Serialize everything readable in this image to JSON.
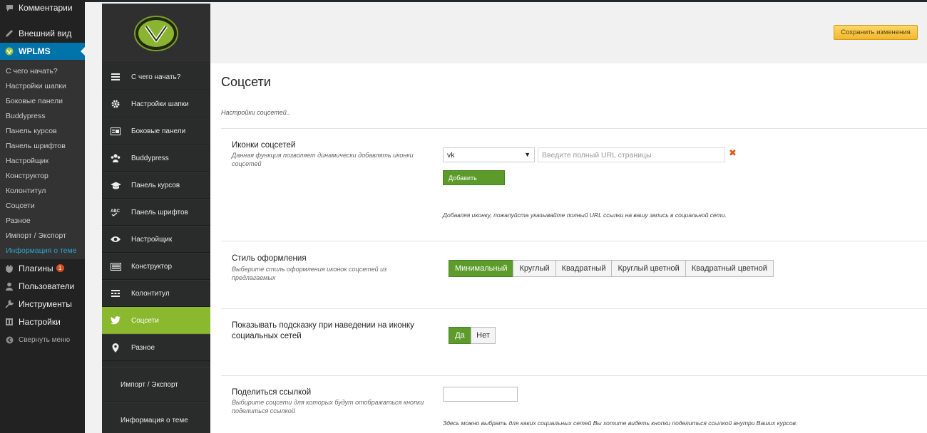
{
  "wp_menu": {
    "top_items": [
      {
        "label": "Комментарии",
        "icon": "comment-icon"
      },
      {
        "label": "Внешний вид",
        "icon": "paintbrush-icon"
      },
      {
        "label": "WPLMS",
        "icon": "wplms-logo-icon"
      }
    ],
    "sub_items": [
      "С чего начать?",
      "Настройки шапки",
      "Боковые панели",
      "Buddypress",
      "Панель курсов",
      "Панель шрифтов",
      "Настройщик",
      "Конструктор",
      "Колонтитул",
      "Соцсети",
      "Разное",
      "Импорт / Экспорт",
      "Информация о теме"
    ],
    "bottom_items": [
      {
        "label": "Плагины",
        "icon": "plugin-icon",
        "badge": "1"
      },
      {
        "label": "Пользователи",
        "icon": "user-icon"
      },
      {
        "label": "Инструменты",
        "icon": "wrench-icon"
      },
      {
        "label": "Настройки",
        "icon": "settings-icon"
      },
      {
        "label": "Свернуть меню",
        "icon": "collapse-icon"
      }
    ]
  },
  "options_sidebar": {
    "items": [
      {
        "label": "С чего начать?",
        "icon": "menu-icon"
      },
      {
        "label": "Настройки шапки",
        "icon": "gear-icon"
      },
      {
        "label": "Боковые панели",
        "icon": "sidebar-icon"
      },
      {
        "label": "Buddypress",
        "icon": "group-icon"
      },
      {
        "label": "Панель курсов",
        "icon": "graduation-cap-icon"
      },
      {
        "label": "Панель шрифтов",
        "icon": "font-abc-icon"
      },
      {
        "label": "Настройщик",
        "icon": "eye-icon"
      },
      {
        "label": "Конструктор",
        "icon": "keyboard-icon"
      },
      {
        "label": "Колонтитул",
        "icon": "footer-icon"
      },
      {
        "label": "Соцсети",
        "icon": "twitter-bird-icon"
      },
      {
        "label": "Разное",
        "icon": "map-pin-icon"
      }
    ],
    "plain_items": [
      "Импорт / Экспорт",
      "Информация о теме"
    ]
  },
  "header": {
    "save_label": "Сохранить изменения"
  },
  "page": {
    "title": "Соцсети",
    "description": "Настройки соцсетей.."
  },
  "social_icons": {
    "title": "Иконки соцсетей",
    "desc": "Данная функция позволяет динамически добавлять иконки соцсетей",
    "select_value": "vk",
    "url_placeholder": "Введите полный URL страницы",
    "add_label": "Добавить",
    "hint": "Добавляя иконку, пожалуйста указывайте полный URL ссылки на вашу запись в социальной сети."
  },
  "style": {
    "title": "Стиль оформления",
    "desc": "Выберите стиль оформления иконок соцсетей из предлагаемых",
    "options": [
      "Минимальный",
      "Круглый",
      "Квадратный",
      "Круглый цветной",
      "Квадратный цветной"
    ],
    "selected": "Минимальный"
  },
  "tooltip": {
    "title": "Показывать подсказку при наведении на иконку социальных сетей",
    "yes": "Да",
    "no": "Нет"
  },
  "share": {
    "title": "Поделиться ссылкой",
    "desc": "Выбирите соцсети для которых будут отображаться кнопки поделиться ссылкой",
    "hint": "Здесь можно выбрать для каких социальных сетей Вы хотите видеть кнопки поделиться ссылкой внутри Ваших курсов."
  },
  "colors": {
    "wp_active": "#0073aa",
    "theme_active": "#8ab82e",
    "save_button": "#f2b82c",
    "add_button": "#5b9a2b"
  }
}
